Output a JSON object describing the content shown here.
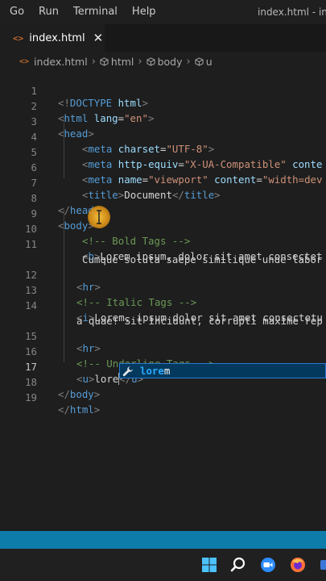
{
  "menu": {
    "items": [
      "Go",
      "Run",
      "Terminal",
      "Help"
    ],
    "window_title": "index.html - ind"
  },
  "tab": {
    "label": "index.html",
    "icon": "html-file-icon",
    "close": "✕"
  },
  "breadcrumb": {
    "file": "index.html",
    "items": [
      "html",
      "body",
      "u"
    ]
  },
  "editor": {
    "active_line": 17,
    "lines": [
      {
        "n": "1"
      },
      {
        "n": "2"
      },
      {
        "n": "3"
      },
      {
        "n": "4"
      },
      {
        "n": "5"
      },
      {
        "n": "6"
      },
      {
        "n": "7"
      },
      {
        "n": "8"
      },
      {
        "n": "9"
      },
      {
        "n": "10"
      },
      {
        "n": "11"
      },
      {
        "n": "12"
      },
      {
        "n": "13"
      },
      {
        "n": "14"
      },
      {
        "n": "15"
      },
      {
        "n": "16"
      },
      {
        "n": "17"
      },
      {
        "n": "18"
      },
      {
        "n": "19"
      }
    ],
    "code": {
      "l1": {
        "a": "<!",
        "b": "DOCTYPE",
        "c": " html",
        "d": ">"
      },
      "l2": {
        "a": "<",
        "b": "html",
        "c": " lang",
        "d": "=",
        "e": "\"en\"",
        "f": ">"
      },
      "l3": {
        "a": "<",
        "b": "head",
        "c": ">"
      },
      "l4": {
        "a": "<",
        "b": "meta",
        "c": " charset",
        "d": "=",
        "e": "\"UTF-8\"",
        "f": ">"
      },
      "l5": {
        "a": "<",
        "b": "meta",
        "c": " http-equiv",
        "d": "=",
        "e": "\"X-UA-Compatible\"",
        "f": " conte"
      },
      "l6": {
        "a": "<",
        "b": "meta",
        "c": " name",
        "d": "=",
        "e": "\"viewport\"",
        "f": " content",
        "g": "=",
        "h": "\"width=dev"
      },
      "l7": {
        "a": "<",
        "b": "title",
        "c": ">",
        "d": "Document",
        "e": "</",
        "f": "title",
        "g": ">"
      },
      "l8": {
        "a": "</",
        "b": "head",
        "c": ">"
      },
      "l9": {
        "a": "<",
        "b": "body",
        "c": ">"
      },
      "l10": {
        "a": "<!-- Bold Tags -->"
      },
      "l11": {
        "a": "<",
        "b": "b",
        "c": ">",
        "d": "Lorem ipsum, dolor sit amet consectet",
        "e": "Cumque soluta saepe similique unde labor"
      },
      "l12": {
        "a": "<",
        "b": "hr",
        "c": ">"
      },
      "l13": {
        "a": "<!-- Italic Tags -->"
      },
      "l14": {
        "a": "<",
        "b": "i",
        "c": ">",
        "d": "Lorem, ipsum dolor sit amet consectetu",
        "e": "a quae! Sit incidunt, corrupti maxime rep"
      },
      "l15": {
        "a": "<",
        "b": "hr",
        "c": ">"
      },
      "l16": {
        "a": "<!-- Underline Tags -->"
      },
      "l17": {
        "a": "<",
        "b": "u",
        "c": ">",
        "d": "lore",
        "e": "</",
        "f": "u",
        "g": ">"
      },
      "l18": {
        "a": "</",
        "b": "body",
        "c": ">"
      },
      "l19": {
        "a": "</",
        "b": "html",
        "c": ">"
      }
    }
  },
  "suggestion": {
    "match": "lore",
    "rest": "m",
    "icon": "wrench-icon"
  },
  "colors": {
    "status_bar": "#0e7cab",
    "suggest_bg": "#04395e",
    "tag": "#569cd6",
    "attr": "#9cdcfe",
    "string": "#ce9178",
    "comment": "#6a9955"
  },
  "taskbar": {
    "icons": [
      "windows-start-icon",
      "search-icon",
      "zoom-icon",
      "firefox-icon",
      "app-icon"
    ]
  }
}
